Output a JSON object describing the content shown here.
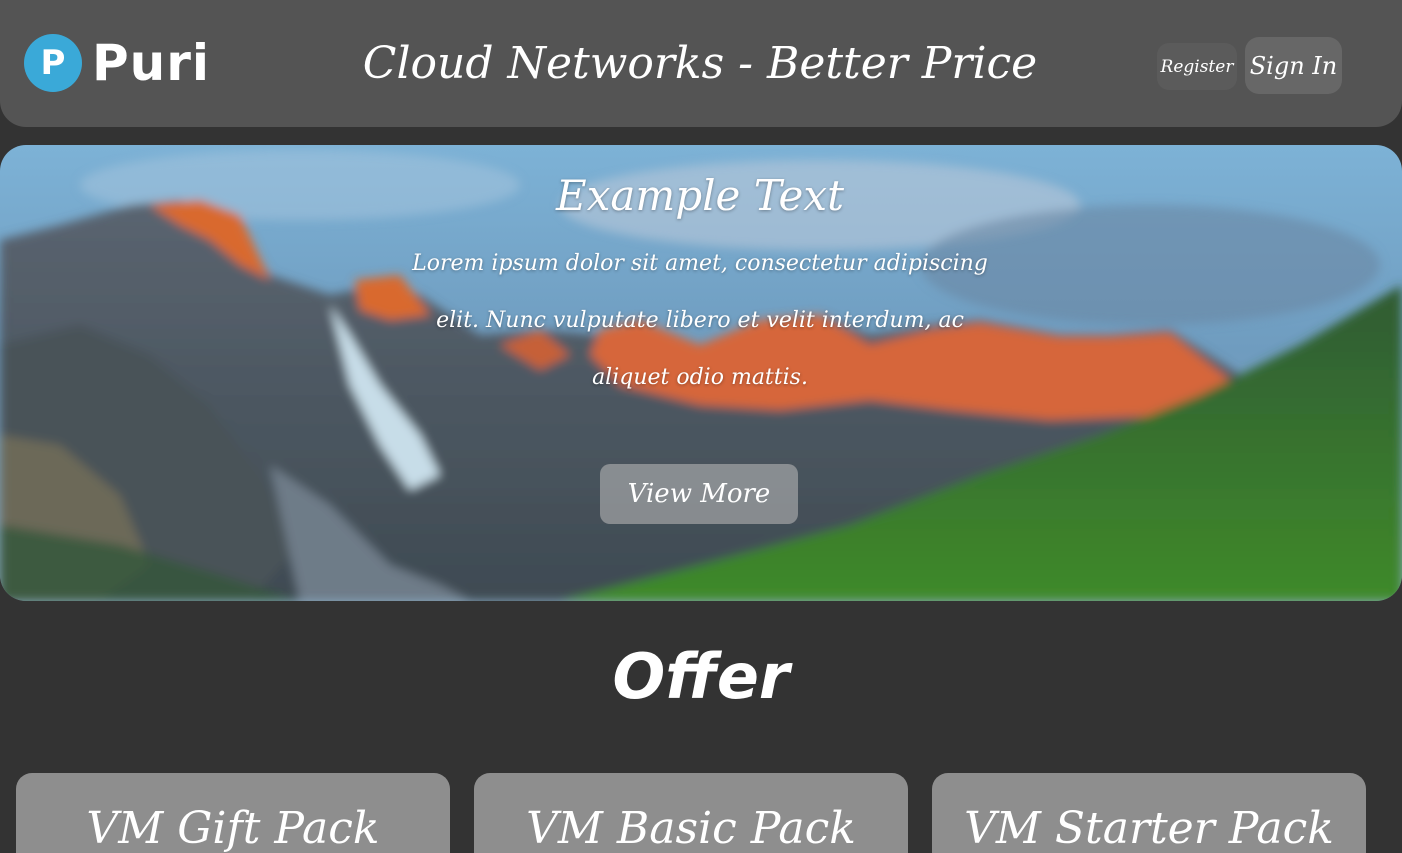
{
  "header": {
    "logo_letter": "P",
    "logo_text": "Puri",
    "title": "Cloud Networks - Better Price",
    "register_label": "Register",
    "signin_label": "Sign In"
  },
  "hero": {
    "title": "Example Text",
    "body": "Lorem ipsum dolor sit amet, consectetur adipiscing elit. Nunc vulputate libero et velit interdum, ac aliquet odio mattis.",
    "button_label": "View More",
    "image": "mountain-landscape"
  },
  "offer": {
    "title": "Offer",
    "cards": [
      {
        "title": "VM Gift Pack"
      },
      {
        "title": "VM Basic Pack"
      },
      {
        "title": "VM Starter Pack"
      }
    ]
  },
  "colors": {
    "page_bg": "#333333",
    "header_bg": "#545454",
    "logo_accent": "#3aa9d8",
    "card_bg": "#8e8e8e"
  }
}
